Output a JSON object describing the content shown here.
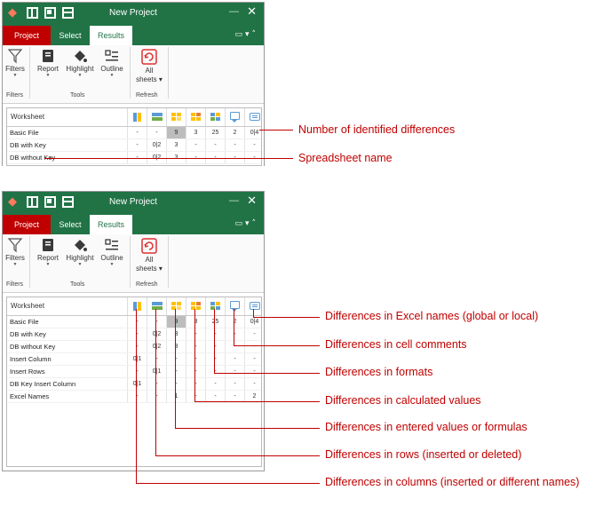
{
  "window": {
    "title": "New Project",
    "tabs": [
      "Project",
      "Select",
      "Results"
    ],
    "active_tab": "Results"
  },
  "ribbon": {
    "filters": "Filters",
    "report": "Report",
    "highlight": "Highlight",
    "outline": "Outline",
    "all_sheets_1": "All",
    "all_sheets_2": "sheets",
    "group_filters": "Filters",
    "group_tools": "Tools",
    "group_refresh": "Refresh"
  },
  "grid": {
    "header_label": "Worksheet",
    "column_icons": [
      "columns-icon",
      "rows-icon",
      "entered-values-icon",
      "calculated-values-icon",
      "formats-icon",
      "comments-icon",
      "names-icon"
    ]
  },
  "top_grid_rows": [
    {
      "name": "Basic File",
      "cells": [
        "-",
        "-",
        "9",
        "3",
        "25",
        "2",
        "0|4"
      ]
    },
    {
      "name": "DB with Key",
      "cells": [
        "-",
        "0|2",
        "3",
        "-",
        "-",
        "-",
        "-"
      ]
    },
    {
      "name": "DB without Key",
      "cells": [
        "-",
        "0|2",
        "3",
        "-",
        "-",
        "-",
        "-"
      ]
    }
  ],
  "bottom_grid_rows": [
    {
      "name": "Basic File",
      "cells": [
        "-",
        "-",
        "9",
        "3",
        "25",
        "2",
        "0|4"
      ]
    },
    {
      "name": "DB with Key",
      "cells": [
        "-",
        "0|2",
        "3",
        "-",
        "-",
        "-",
        "-"
      ]
    },
    {
      "name": "DB without Key",
      "cells": [
        "-",
        "0|2",
        "3",
        "-",
        "-",
        "-",
        "-"
      ]
    },
    {
      "name": "Insert Column",
      "cells": [
        "0|1",
        "-",
        "-",
        "-",
        "-",
        "-",
        "-"
      ]
    },
    {
      "name": "Insert Rows",
      "cells": [
        "-",
        "0|1",
        "-",
        "-",
        "-",
        "-",
        "-"
      ]
    },
    {
      "name": "DB Key Insert Column",
      "cells": [
        "0|1",
        "-",
        "-",
        "-",
        "-",
        "-",
        "-"
      ]
    },
    {
      "name": "Excel Names",
      "cells": [
        "-",
        "-",
        "1",
        "-",
        "-",
        "-",
        "2"
      ]
    }
  ],
  "annotations_top": {
    "diff_count": "Number of identified differences",
    "sheet_name": "Spreadsheet name"
  },
  "annotations_bottom": {
    "names": "Differences in Excel names (global or local)",
    "comments": "Differences in cell comments",
    "formats": "Differences in formats",
    "calculated": "Differences in calculated values",
    "entered": "Differences in entered values or formulas",
    "rows": "Differences in rows (inserted or deleted)",
    "columns": "Differences in columns (inserted or different names)"
  },
  "colors": {
    "title_bar": "#217346",
    "project_tab": "#c00000",
    "annotation": "#c00000"
  }
}
